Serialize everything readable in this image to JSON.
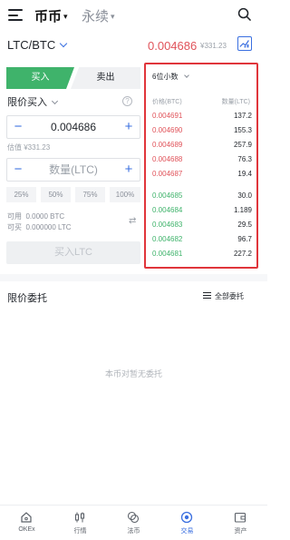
{
  "header": {
    "tab_spot": "币币",
    "tab_perp": "永续",
    "caret": "▾"
  },
  "pair": {
    "symbol": "LTC/BTC",
    "price": "0.004686",
    "cny": "¥331.23"
  },
  "trade": {
    "buy_tab": "买入",
    "sell_tab": "卖出",
    "order_type": "限价买入",
    "help": "?",
    "price_value": "0.004686",
    "minus": "−",
    "plus": "+",
    "estimate": "估值 ¥331.23",
    "amount_placeholder": "数量(LTC)",
    "percents": [
      "25%",
      "50%",
      "75%",
      "100%"
    ],
    "available_label": "可用",
    "available_value": "0.0000 BTC",
    "buyable_label": "可买",
    "buyable_value": "0.000000 LTC",
    "buy_button": "买入LTC"
  },
  "book": {
    "decimals": "6位小数",
    "price_header": "价格(BTC)",
    "qty_header": "数量(LTC)",
    "asks": [
      {
        "price": "0.004691",
        "qty": "137.2"
      },
      {
        "price": "0.004690",
        "qty": "155.3"
      },
      {
        "price": "0.004689",
        "qty": "257.9"
      },
      {
        "price": "0.004688",
        "qty": "76.3"
      },
      {
        "price": "0.004687",
        "qty": "19.4"
      }
    ],
    "bids": [
      {
        "price": "0.004685",
        "qty": "30.0"
      },
      {
        "price": "0.004684",
        "qty": "1.189"
      },
      {
        "price": "0.004683",
        "qty": "29.5"
      },
      {
        "price": "0.004682",
        "qty": "96.7"
      },
      {
        "price": "0.004681",
        "qty": "227.2"
      }
    ],
    "highlight_color": "#e0353b"
  },
  "orders": {
    "title": "限价委托",
    "all": "全部委托",
    "empty": "本币对暂无委托"
  },
  "nav": [
    {
      "label": "OKEx",
      "icon": "home-icon"
    },
    {
      "label": "行情",
      "icon": "market-icon"
    },
    {
      "label": "法币",
      "icon": "fiat-icon"
    },
    {
      "label": "交易",
      "icon": "trade-icon",
      "active": true
    },
    {
      "label": "资产",
      "icon": "wallet-icon"
    }
  ],
  "colors": {
    "up": "#3fb36b",
    "down": "#e0535a",
    "accent": "#3a6fe0"
  }
}
